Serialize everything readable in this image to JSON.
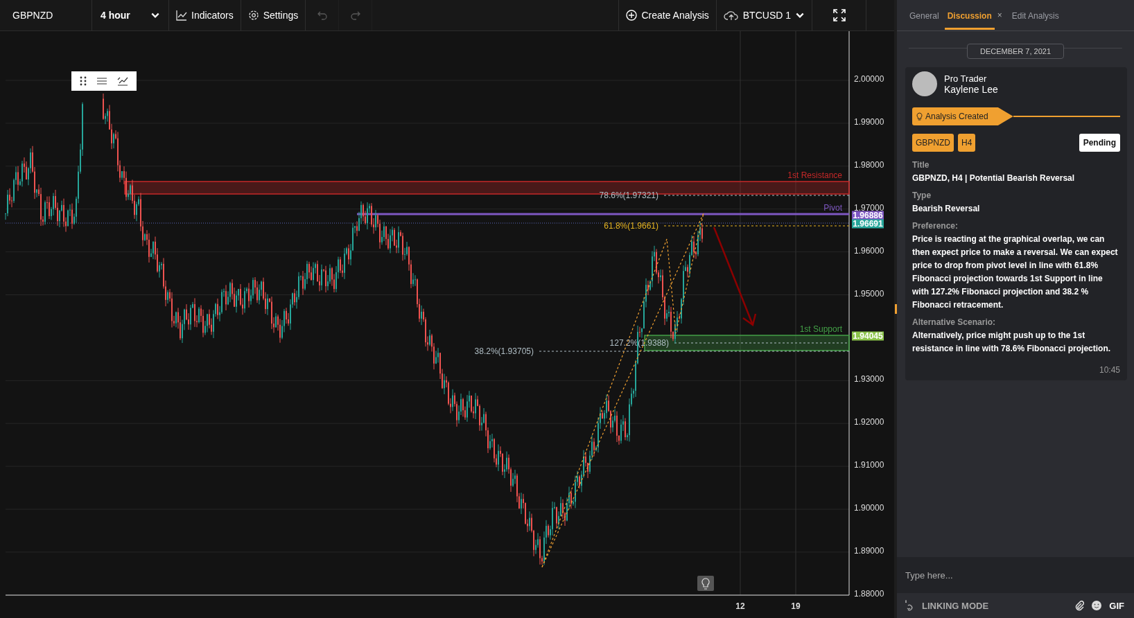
{
  "toolbar": {
    "symbol": "GBPNZD",
    "timeframe": "4 hour",
    "buttons": [
      {
        "kind": "indicators",
        "label": "Indicators"
      },
      {
        "kind": "settings",
        "label": "Settings"
      }
    ],
    "history": [
      {
        "kind": "undo",
        "disabled": true
      },
      {
        "kind": "redo",
        "disabled": true
      }
    ],
    "create_analysis": "Create Analysis",
    "account": "BTCUSD 1"
  },
  "chart": {
    "price_ticks": [
      "2.00000",
      "1.99000",
      "1.98000",
      "1.97000",
      "1.96000",
      "1.95000",
      "1.93000",
      "1.92000",
      "1.91000",
      "1.90000",
      "1.89000",
      "1.88000"
    ],
    "date_ticks": [
      "12",
      "19"
    ],
    "levels": [
      {
        "kind": "zone",
        "label": "1st Resistance",
        "color": "#c62828"
      },
      {
        "kind": "line",
        "label": "Pivot",
        "color": "#7e57c2"
      },
      {
        "kind": "zone",
        "label": "1st Support",
        "color": "#43a047"
      }
    ],
    "fib_labels": [
      {
        "label": "78.6%(1.97321)",
        "color": "#b0bec5"
      },
      {
        "label": "61.8%(1.9661)",
        "color": "#e6b422"
      },
      {
        "label": "127.2%(1.9388)",
        "color": "#b0bec5"
      },
      {
        "label": "38.2%(1.93705)",
        "color": "#b0bec5"
      }
    ],
    "price_tags": [
      {
        "text": "1.96886",
        "color": "#7e57c2"
      },
      {
        "text": "1.96691",
        "color": "#26a69a"
      },
      {
        "text": "1.94045",
        "color": "#8bc34a"
      }
    ]
  },
  "panel": {
    "tabs": [
      {
        "label": "General",
        "selected": false
      },
      {
        "label": "Discussion",
        "selected": true,
        "close": "×"
      },
      {
        "label": "Edit Analysis",
        "selected": false
      }
    ],
    "date": "DECEMBER 7, 2021",
    "post": {
      "role": "Pro Trader",
      "name": "Kaylene Lee",
      "banner": "Analysis Created",
      "tags": [
        "GBPNZD",
        "H4"
      ],
      "status": "Pending",
      "fields": [
        {
          "label": "Title",
          "value": "GBPNZD, H4 | Potential Bearish Reversal"
        },
        {
          "label": "Type",
          "value": "Bearish Reversal"
        },
        {
          "label": "Preference:",
          "value": "Price is reacting at the graphical overlap, we can then expect price to make a reversal. We can expect price to drop from **pivot level** in line with **61.8% Fibonacci projection** towards **1st Support** in line with **127.2% Fibonacci projection** and **38.2 % Fibonacci retracement.**"
        },
        {
          "label": "Alternative Scenario:",
          "value": "Alternatively, price might push up to the **1st resistance** in line with **78.6% Fibonacci projection.**"
        }
      ],
      "time": "10:45"
    },
    "composer": {
      "placeholder": "Type here...",
      "linking_mode": "LINKING MODE",
      "gif": "GIF"
    }
  }
}
